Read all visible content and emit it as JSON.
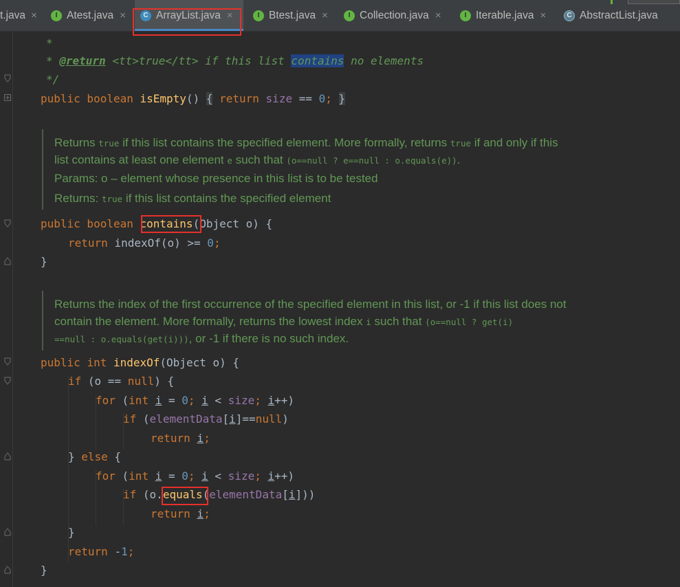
{
  "tabs": [
    {
      "name": "t.java",
      "icon": "none",
      "active": false
    },
    {
      "name": "Atest.java",
      "icon": "interface-icon"
    },
    {
      "name": "ArrayList.java",
      "icon": "class-icon",
      "active": true
    },
    {
      "name": "Btest.java",
      "icon": "interface-icon"
    },
    {
      "name": "Collection.java",
      "icon": "interface-icon"
    },
    {
      "name": "Iterable.java",
      "icon": "interface-icon"
    },
    {
      "name": "AbstractList.java",
      "icon": "abstract-class-icon"
    }
  ],
  "tab_close_glyph": "×",
  "icons": {
    "interface": "I",
    "class": "C",
    "abstract": "C"
  },
  "colors": {
    "keyword": "#cc7832",
    "number": "#6897bb",
    "field": "#9876aa",
    "method": "#ffc66d",
    "doc": "#629755",
    "highlight_box": "#e8302b",
    "selection": "#214283"
  },
  "code": {
    "l1": "*",
    "l2_star": "* ",
    "l2_tag": "@return",
    "l2_a": " <tt>true</tt> if this list ",
    "l2_hl": "contains",
    "l2_b": " no elements",
    "l3": "*/",
    "isEmpty": {
      "kw": "public boolean ",
      "name": "isEmpty",
      "paren": "()",
      "sp": " ",
      "lb": "{",
      "ret": " return ",
      "size": "size",
      "eq": " == ",
      "zero": "0",
      "semi": ";",
      "sp2": " ",
      "rb": "}"
    },
    "contains": {
      "kw": "public boolean ",
      "name": "contains",
      "rest": "(Object o) {"
    },
    "contains_body": {
      "ret": "return ",
      "call": "indexOf(o) >= ",
      "zero": "0",
      "semi": ";"
    },
    "close": "}",
    "indexOf": {
      "kw1": "public ",
      "kw2": "int ",
      "name": "indexOf",
      "rest": "(Object o) {"
    },
    "if_null": {
      "kw": "if ",
      "a": "(o == ",
      "null": "null",
      "b": ") {"
    },
    "for1": {
      "kw": "for ",
      "a": "(",
      "int": "int ",
      "i": "i",
      "b": " = ",
      "zero": "0",
      "c": "; ",
      "i2": "i",
      "d": " < ",
      "size": "size",
      "e": "; ",
      "i3": "i",
      "f": "++)"
    },
    "if_elem": {
      "kw": "if ",
      "a": "(",
      "fld": "elementData",
      "b": "[",
      "i": "i",
      "c": "]==",
      "null": "null",
      "d": ")"
    },
    "ret_i": {
      "kw": "return ",
      "i": "i",
      "semi": ";"
    },
    "else": {
      "a": "} ",
      "kw": "else",
      "b": " {"
    },
    "if_eq": {
      "kw": "if ",
      "a": "(o.",
      "name": "equals",
      "b": "(",
      "fld": "elementData",
      "c": "[",
      "i": "i",
      "d": "]))"
    },
    "ret_neg": {
      "kw": "return ",
      "minus": "-",
      "one": "1",
      "semi": ";"
    }
  },
  "doc_contains": {
    "l1a": "Returns ",
    "l1m": "true",
    "l1b": " if this list contains the specified element. More formally, returns ",
    "l1m2": "true",
    "l1c": " if and only if this",
    "l2a": "list contains at least one element ",
    "l2m": "e",
    "l2b": " such that ",
    "l2m2": "(o==null  ?  e==null  :  o.equals(e))",
    "l2c": ".",
    "l3": "Params:  o – element whose presence in this list is to be tested",
    "l4a": "Returns:  ",
    "l4m": "true",
    "l4b": " if this list contains the specified element"
  },
  "doc_indexOf": {
    "l1": "Returns the index of the first occurrence of the specified element in this list, or -1 if this list does not",
    "l2a": "contain the element. More formally, returns the lowest index ",
    "l2m": "i",
    "l2b": " such that ",
    "l2m2": "(o==null  ?  get(i)",
    "l3m": "==null  :  o.equals(get(i)))",
    "l3b": ", or -1 if there is no such index."
  }
}
